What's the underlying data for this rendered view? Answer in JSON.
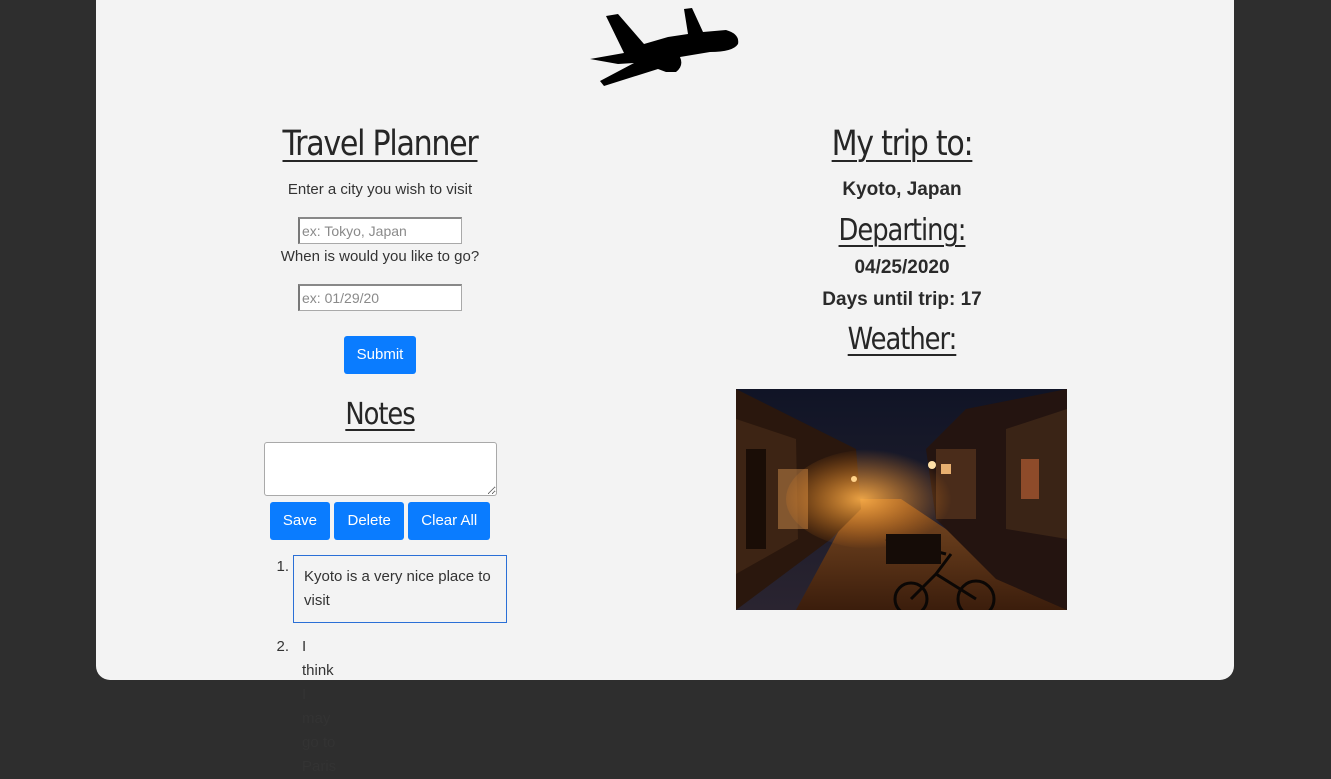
{
  "planner": {
    "title": "Travel Planner",
    "city_prompt": "Enter a city you wish to visit",
    "city_placeholder": "ex: Tokyo, Japan",
    "date_prompt": "When is would you like to go?",
    "date_placeholder": "ex: 01/29/20",
    "submit_label": "Submit"
  },
  "notes": {
    "title": "Notes",
    "save_label": "Save",
    "delete_label": "Delete",
    "clear_label": "Clear All",
    "items": [
      {
        "number": "1.",
        "text": "Kyoto is a very nice place to visit"
      },
      {
        "number": "2.",
        "text": "I think I may go to Paris"
      }
    ]
  },
  "trip": {
    "title": "My trip to:",
    "destination": "Kyoto, Japan",
    "departing_title": "Departing:",
    "departing_date": "04/25/2020",
    "days_until": "Days until trip: 17",
    "weather_title": "Weather:"
  },
  "icons": {
    "plane": "airplane-icon"
  },
  "colors": {
    "accent": "#0a7cff",
    "background": "#2e2e2e",
    "card": "#f3f3f3"
  }
}
